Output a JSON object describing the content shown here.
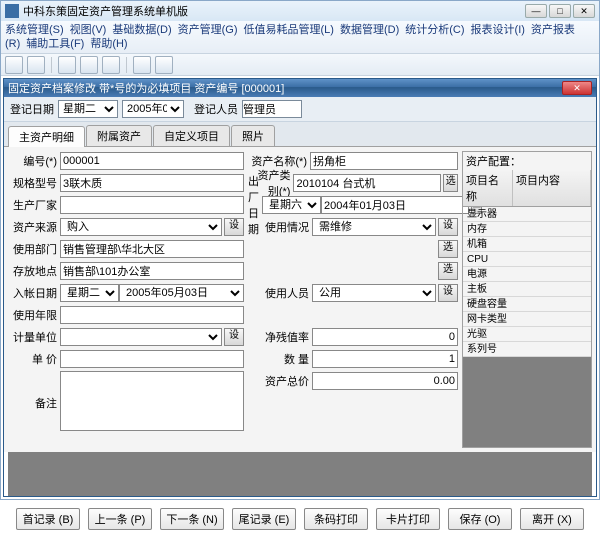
{
  "outerTitle": "中科东策固定资产管理系统单机版",
  "menus": [
    "系统管理(S)",
    "视图(V)",
    "基础数据(D)",
    "资产管理(G)",
    "低值易耗品管理(L)",
    "数据管理(D)",
    "统计分析(C)",
    "报表设计(I)",
    "资产报表(R)",
    "辅助工具(F)",
    "帮助(H)"
  ],
  "innerTitle": "固定资产档案修改 带*号的为必填项目 资产编号 [000001]",
  "register": {
    "dateLabel": "登记日期",
    "day": "星期二",
    "year": "2005年0",
    "personLabel": "登记人员",
    "person": "管理员"
  },
  "tabs": [
    "主资产明细",
    "附属资产",
    "自定义项目",
    "照片"
  ],
  "L": {
    "code": {
      "l": "编号(*)",
      "v": "000001"
    },
    "spec": {
      "l": "规格型号",
      "v": "3联木质"
    },
    "maker": {
      "l": "生产厂家",
      "v": ""
    },
    "source": {
      "l": "资产来源",
      "v": "购入"
    },
    "dept": {
      "l": "使用部门",
      "v": "销售管理部\\华北大区"
    },
    "loc": {
      "l": "存放地点",
      "v": "销售部\\101办公室"
    },
    "indate": {
      "l": "入帐日期",
      "day": "星期二",
      "d": "2005年05月03日"
    },
    "years": {
      "l": "使用年限",
      "v": ""
    },
    "unit": {
      "l": "计量单位",
      "v": ""
    },
    "price": {
      "l": "单    价",
      "v": ""
    }
  },
  "M": {
    "name": {
      "l": "资产名称(*)",
      "v": "拐角柜"
    },
    "cat": {
      "l": "资产类别(*)",
      "v": "2010104 台式机"
    },
    "outdate": {
      "l": "出厂日期",
      "day": "星期六",
      "d": "2004年01月03日"
    },
    "status": {
      "l": "使用情况",
      "v": "需维修"
    },
    "user": {
      "l": "使用人员",
      "v": "公用"
    },
    "residual": {
      "l": "净残值率",
      "v": "0"
    },
    "qty": {
      "l": "数    量",
      "v": "1"
    },
    "total": {
      "l": "资产总价",
      "v": "0.00"
    }
  },
  "cfg": {
    "title": "资产配置：",
    "h1": "项目名称",
    "h2": "项目内容",
    "items": [
      "显示器",
      "内存",
      "机箱",
      "CPU",
      "电源",
      "主板",
      "硬盘容量",
      "网卡类型",
      "光驱",
      "系列号"
    ]
  },
  "remarkLabel": "备注",
  "setBtn": "设",
  "selBtn": "选",
  "bottom": [
    "首记录 (B)",
    "上一条 (P)",
    "下一条 (N)",
    "尾记录 (E)",
    "条码打印",
    "卡片打印",
    "保存 (O)",
    "离开 (X)"
  ]
}
